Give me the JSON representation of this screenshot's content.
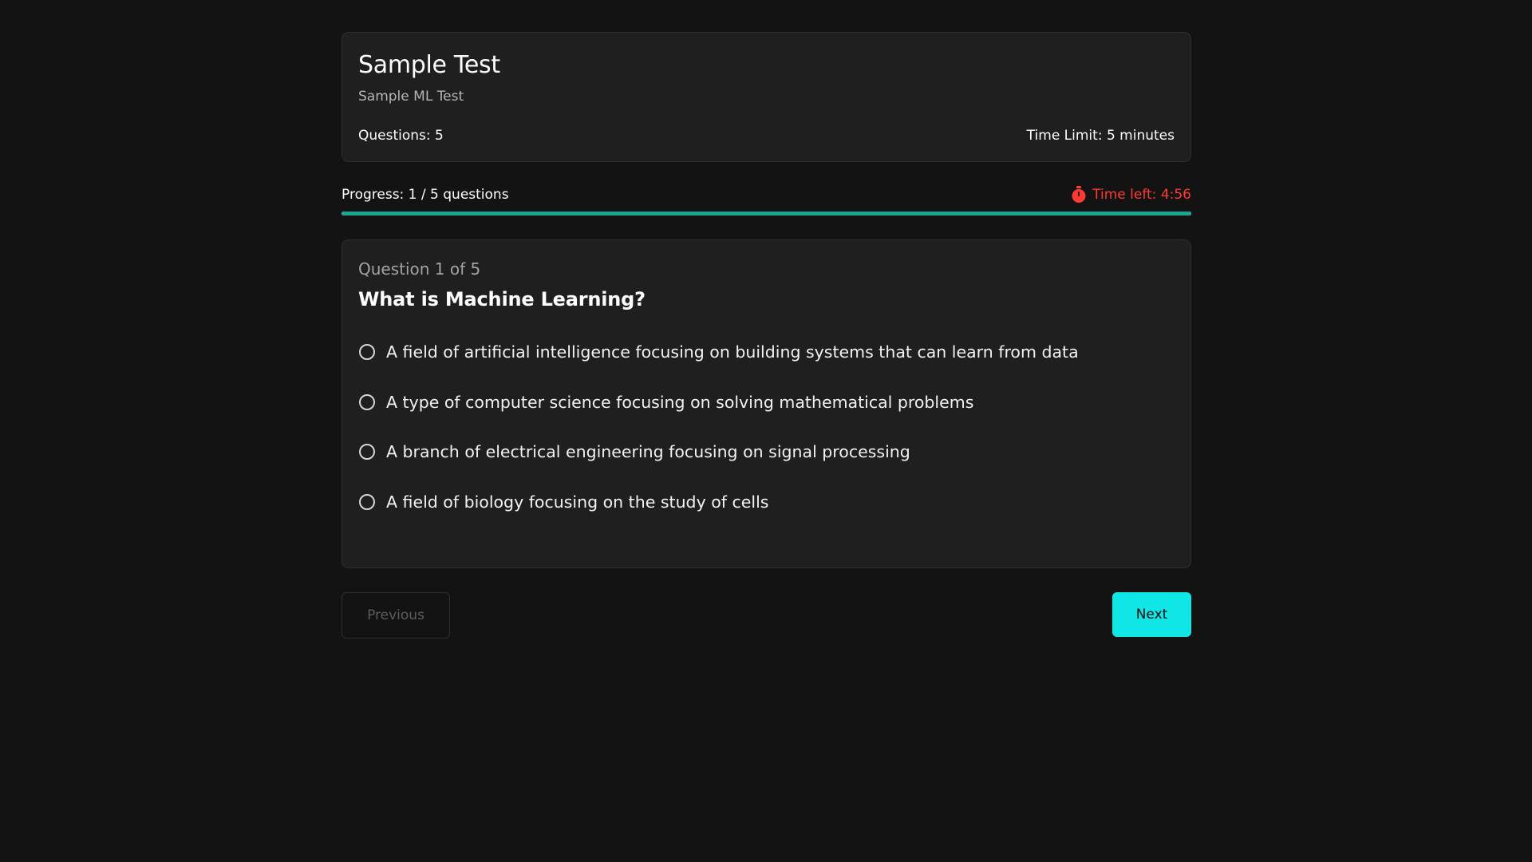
{
  "test": {
    "title": "Sample Test",
    "description": "Sample ML Test",
    "questions_label": "Questions: 5",
    "time_limit_label": "Time Limit: 5 minutes"
  },
  "progress": {
    "label": "Progress: 1 / 5 questions",
    "timer_label": "Time left: 4:56",
    "fill_percent": 100,
    "colors": {
      "bar": "#1fa38e",
      "timer": "#ff3b30"
    }
  },
  "question": {
    "counter": "Question 1 of 5",
    "text": "What is Machine Learning?",
    "options": [
      "A field of artificial intelligence focusing on building systems that can learn from data",
      "A type of computer science focusing on solving mathematical problems",
      "A branch of electrical engineering focusing on signal processing",
      "A field of biology focusing on the study of cells"
    ]
  },
  "nav": {
    "previous_label": "Previous",
    "next_label": "Next",
    "next_color": "#10e6e6"
  },
  "icons": {
    "timer": "stopwatch-icon",
    "option": "radio-unchecked-icon"
  }
}
